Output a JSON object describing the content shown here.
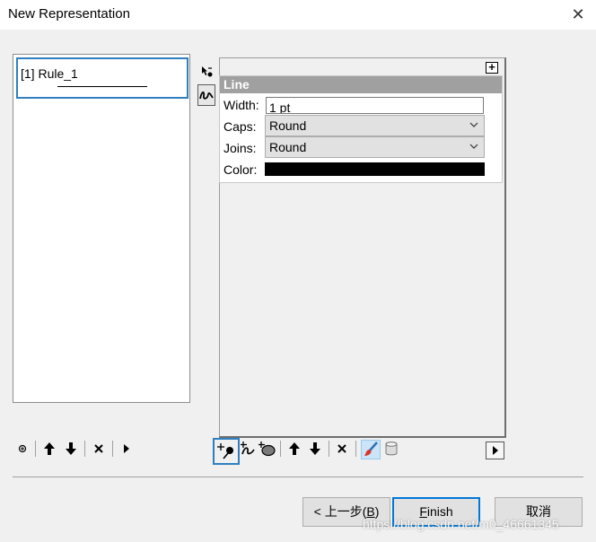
{
  "window": {
    "title": "New Representation",
    "close_glyph": "✕"
  },
  "rules": [
    {
      "label": "[1] Rule_1"
    }
  ],
  "side_tools": [
    {
      "icon": "marker-symbol-icon"
    },
    {
      "icon": "line-symbol-icon",
      "selected": true
    }
  ],
  "expand_glyph": "+",
  "line_panel": {
    "header": "Line",
    "width": {
      "label": "Width:",
      "value": "1 pt"
    },
    "caps": {
      "label": "Caps:",
      "value": "Round"
    },
    "joins": {
      "label": "Joins:",
      "value": "Round"
    },
    "color": {
      "label": "Color:",
      "value": "#000000"
    }
  },
  "left_toolbar": [
    {
      "icon": "add-rule-icon"
    },
    {
      "icon": "move-up-icon",
      "glyph": "🡅"
    },
    {
      "icon": "move-down-icon",
      "glyph": "🡇"
    },
    {
      "icon": "delete-rule-icon",
      "glyph": "✕"
    },
    {
      "icon": "more-arrow-icon",
      "glyph": "▶"
    }
  ],
  "effects_toolbar": [
    {
      "icon": "add-marker-icon"
    },
    {
      "icon": "add-stroke-icon"
    },
    {
      "icon": "add-fill-icon"
    },
    {
      "icon": "move-up-icon"
    },
    {
      "icon": "move-down-icon"
    },
    {
      "icon": "delete-effect-icon"
    },
    {
      "icon": "brush-icon"
    },
    {
      "icon": "database-icon"
    },
    {
      "icon": "expand-right-icon"
    }
  ],
  "buttons": {
    "back": {
      "text": "< 上一步(",
      "mnemonic": "B",
      "suffix": ")"
    },
    "finish": {
      "mnemonic": "F",
      "rest": "inish"
    },
    "cancel": "取消"
  },
  "watermark": "https://blog.csdn.net/m0_46661345",
  "colors": {
    "accent": "#2f7fc1",
    "header_bg": "#a0a0a0",
    "default_button_border": "#0078d7"
  }
}
